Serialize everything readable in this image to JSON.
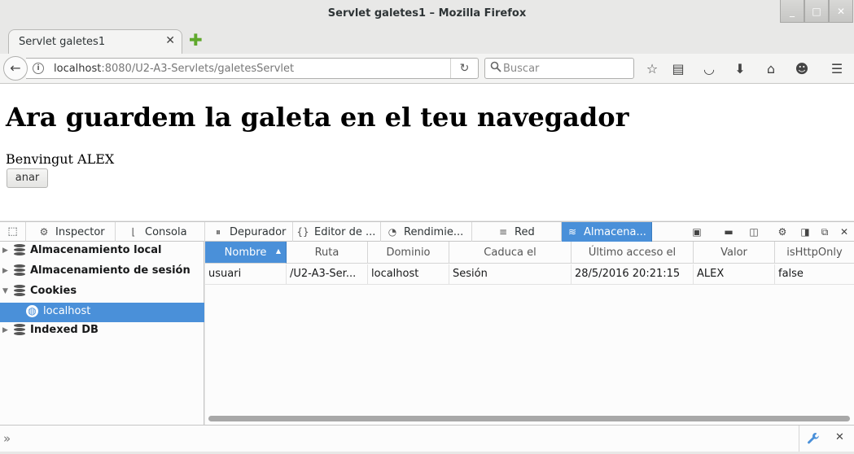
{
  "window": {
    "title": "Servlet galetes1 – Mozilla Firefox",
    "minimize_glyph": "_",
    "maximize_glyph": "□",
    "close_glyph": "✕"
  },
  "tabs": [
    {
      "label": "Servlet galetes1",
      "close_glyph": "✕"
    }
  ],
  "new_tab_glyph": "✚",
  "navbar": {
    "back_glyph": "←",
    "info_glyph": "i",
    "url_host": "localhost",
    "url_rest": ":8080/U2-A3-Servlets/galetesServlet",
    "reload_glyph": "↻",
    "search_placeholder": "Buscar",
    "search_glyph": "🔍",
    "toolbar_icons": {
      "bookmark-star": "☆",
      "reading-list": "▤",
      "pocket": "◡",
      "downloads": "⬇",
      "home": "⌂",
      "chat": "☻",
      "menu": "☰"
    }
  },
  "page": {
    "heading": "Ara guardem la galeta en el teu navegador",
    "welcome": "Benvingut ALEX",
    "button_label": "anar"
  },
  "devtools": {
    "picker_glyph": "⬚",
    "tabs": [
      {
        "id": "inspector",
        "label": "Inspector",
        "icon": "⚙"
      },
      {
        "id": "console",
        "label": "Consola",
        "icon": "⌊"
      },
      {
        "id": "debugger",
        "label": "Depurador",
        "icon": "⏸"
      },
      {
        "id": "style-editor",
        "label": "Editor de ...",
        "icon": "{}"
      },
      {
        "id": "performance",
        "label": "Rendimie...",
        "icon": "◔"
      },
      {
        "id": "network",
        "label": "Red",
        "icon": "≡"
      },
      {
        "id": "storage",
        "label": "Almacena...",
        "icon": "≋"
      }
    ],
    "tool_icons": {
      "responsive": "▣",
      "scratchpad": "▬",
      "screenshot": "◫",
      "settings": "⚙",
      "dock-side": "◨",
      "undock": "⧉",
      "close": "✕"
    },
    "sidebar": [
      {
        "label": "Almacenamiento local",
        "expanded": false
      },
      {
        "label": "Almacenamiento de sesión",
        "expanded": false
      },
      {
        "label": "Cookies",
        "expanded": true
      },
      {
        "label": "localhost",
        "selected": true
      },
      {
        "label": "Indexed DB",
        "expanded": false
      }
    ],
    "columns": [
      "Nombre",
      "Ruta",
      "Dominio",
      "Caduca el",
      "Último acceso el",
      "Valor",
      "isHttpOnly"
    ],
    "rows": [
      [
        "usuari",
        "/U2-A3-Ser...",
        "localhost",
        "Sesión",
        "28/5/2016 20:21:15",
        "ALEX",
        "false"
      ]
    ],
    "console": {
      "prompt_glyph": "»",
      "wrench_glyph": "🔧",
      "close_glyph": "✕"
    }
  },
  "colors": {
    "accent": "#4a90d9",
    "chrome_bg": "#e8e8e7"
  }
}
